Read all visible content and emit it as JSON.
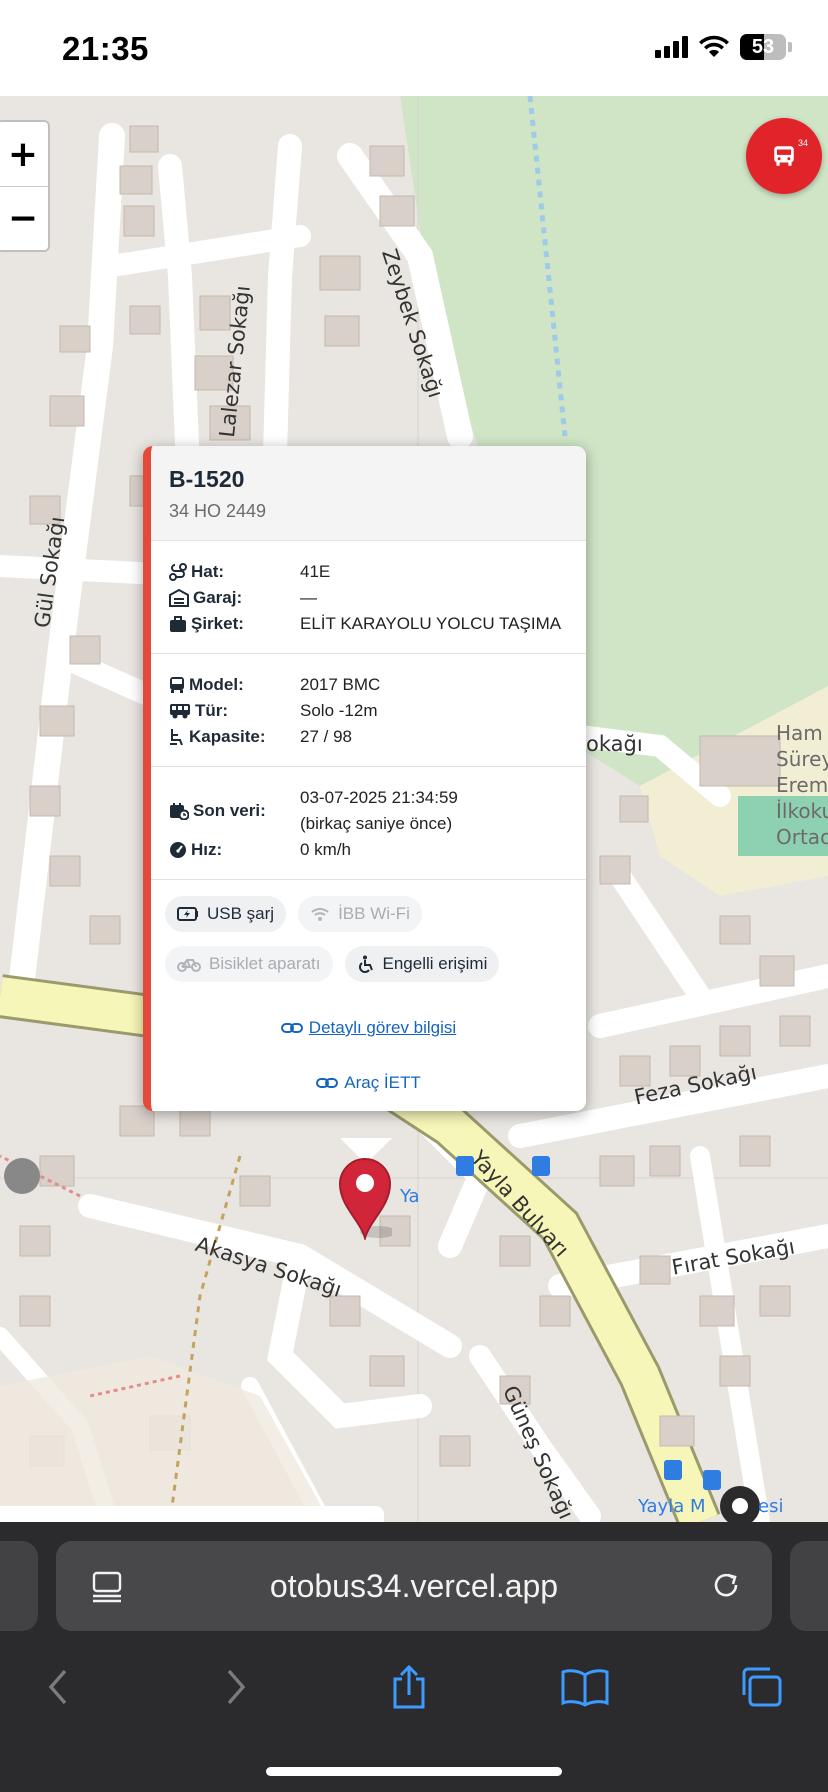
{
  "status_bar": {
    "time": "21:35",
    "battery": "53"
  },
  "map": {
    "zoom_in": "+",
    "zoom_out": "−",
    "fab_badge": "34",
    "streets": {
      "lalezar": "Lalezar Sokağı",
      "zeybek": "Zeybek Sokağı",
      "gul": "Gül Sokağı",
      "kagi": "okağı",
      "feza": "Feza Sokağı",
      "yayla_bulvari": "Yayla Bulvarı",
      "akasya": "Akasya Sokağı",
      "firat": "Fırat Sokağı",
      "gunes": "Güneş Sokağı"
    },
    "school_lines": [
      "Ham",
      "Sürey",
      "Erem",
      "İlkoku",
      "Ortaok"
    ],
    "stop_labels": {
      "ya": "Ya",
      "yayla_m": "Yayla M",
      "esi": "esi"
    }
  },
  "popup": {
    "title": "B-1520",
    "plate": "34 HO 2449",
    "section1": [
      {
        "key": "Hat:",
        "value": "41E",
        "icon": "route-icon"
      },
      {
        "key": "Garaj:",
        "value": "—",
        "icon": "warehouse-icon"
      },
      {
        "key": "Şirket:",
        "value": "ELİT KARAYOLU YOLCU TAŞIMA",
        "icon": "briefcase-icon"
      }
    ],
    "section2": [
      {
        "key": "Model:",
        "value": "2017 BMC",
        "icon": "bus-icon"
      },
      {
        "key": "Tür:",
        "value": "Solo -12m",
        "icon": "bus-side-icon"
      },
      {
        "key": "Kapasite:",
        "value": "27 / 98",
        "icon": "seat-icon"
      }
    ],
    "section3": {
      "son_veri_key": "Son veri:",
      "son_veri_value": "03-07-2025 21:34:59",
      "son_veri_relative": "(birkaç saniye önce)",
      "hiz_key": "Hız:",
      "hiz_value": "0 km/h"
    },
    "chips": [
      {
        "label": "USB şarj",
        "enabled": true
      },
      {
        "label": "İBB Wi-Fi",
        "enabled": false
      },
      {
        "label": "Bisiklet aparatı",
        "enabled": false
      },
      {
        "label": "Engelli erişimi",
        "enabled": true
      }
    ],
    "link_detail": "Detaylı görev bilgisi",
    "link_iett": "Araç İETT"
  },
  "browser": {
    "url": "otobus34.vercel.app"
  },
  "colors": {
    "accent_red": "#e0242a",
    "popup_border": "#e44a3a",
    "link_blue": "#1565c0",
    "park_green": "#cfe5c6"
  }
}
